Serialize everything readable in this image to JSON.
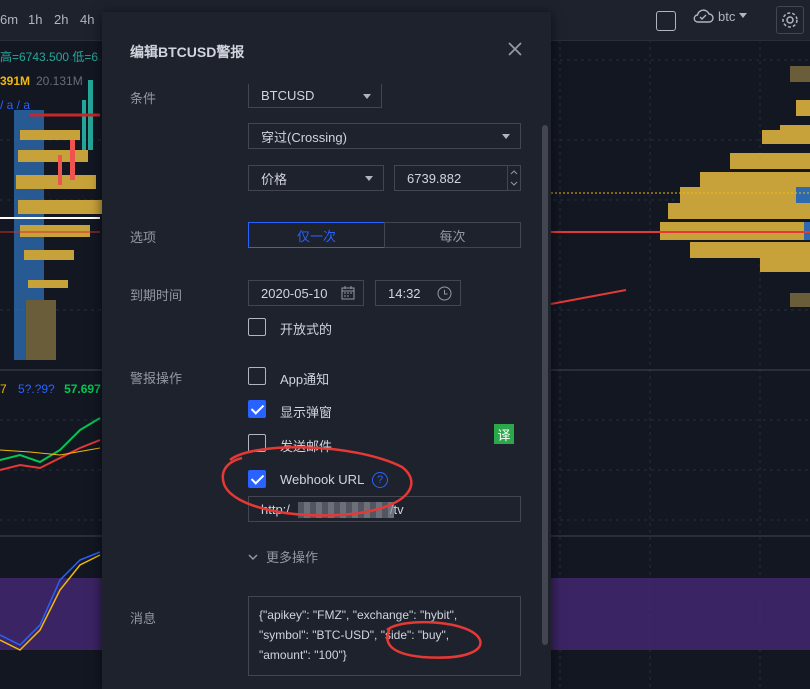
{
  "toolbar": {
    "timeframes": [
      "6m",
      "1h",
      "2h",
      "4h"
    ],
    "symbol_label": "btc"
  },
  "chart": {
    "ohlc_text": "高=6743.500 低=6",
    "volume_primary": "391M",
    "volume_secondary": "20.131M",
    "nan_text": "/ a / a",
    "indicator_value": "57.697",
    "indicator_prefix": "7"
  },
  "dialog": {
    "title": "编辑BTCUSD警报",
    "condition_label": "条件",
    "symbol_select": "BTCUSD",
    "crossing_select": "穿过(Crossing)",
    "price_select": "价格",
    "price_value": "6739.882",
    "options_label": "选项",
    "option_once": "仅一次",
    "option_every": "每次",
    "expiry_label": "到期时间",
    "expiry_date": "2020-05-10",
    "expiry_time": "14:32",
    "open_ended_label": "开放式的",
    "actions_label": "警报操作",
    "action_app": "App通知",
    "action_popup": "显示弹窗",
    "action_email": "发送邮件",
    "action_webhook": "Webhook URL",
    "webhook_url_prefix": "http:/",
    "webhook_url_suffix": "/tv",
    "translate_badge": "译",
    "more_actions": "更多操作",
    "message_label": "消息",
    "message_text": "{\"apikey\": \"FMZ\", \"exchange\": \"hybit\",\n\"symbol\": \"BTC-USD\", \"side\": \"buy\",\n\"amount\": \"100\"}"
  },
  "colors": {
    "accent": "#2962ff",
    "dialog_bg": "#1e222d",
    "chart_bg": "#131722",
    "annotation_red": "#e53935"
  }
}
